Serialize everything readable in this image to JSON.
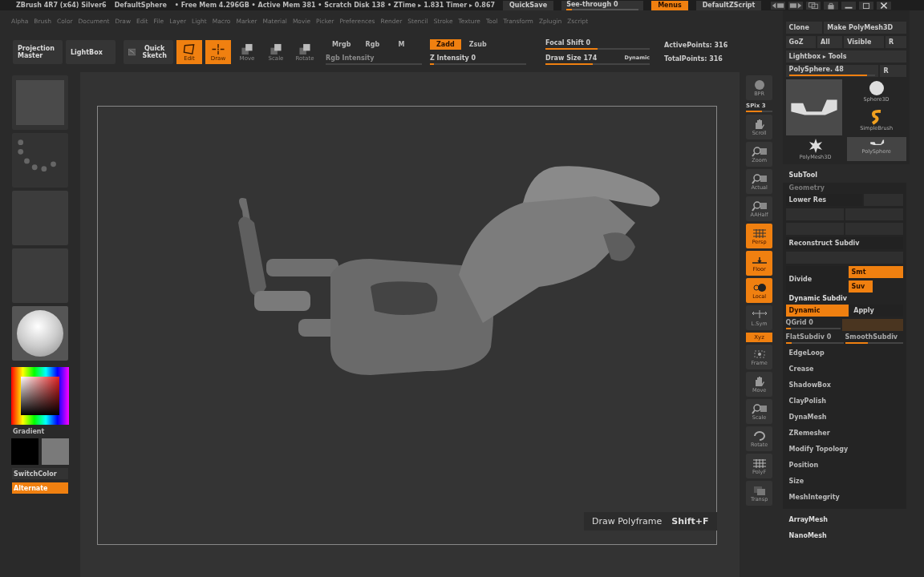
{
  "title_bar": {
    "app": "ZBrush 4R7 (x64) Silver6",
    "document": "DefaultSphere",
    "stats": "• Free Mem 4.296GB • Active Mem 381 • Scratch Disk 138 • ZTime ▸ 1.831 Timer ▸ 0.867",
    "quicksave": "QuickSave",
    "see_through": {
      "label": "See-through  0",
      "level": 0.08
    },
    "menus": {
      "label": "Menus",
      "on": true
    },
    "script": "DefaultZScript"
  },
  "menu_bar": [
    "Alpha",
    "Brush",
    "Color",
    "Document",
    "Draw",
    "Edit",
    "File",
    "Layer",
    "Light",
    "Macro",
    "Marker",
    "Material",
    "Movie",
    "Picker",
    "Preferences",
    "Render",
    "Stencil",
    "Stroke",
    "Texture",
    "Tool",
    "Transform",
    "Zplugin",
    "Zscript"
  ],
  "toolbar": {
    "buttons": [
      {
        "label": "Projection Master",
        "kind": "plain",
        "on": false
      },
      {
        "label": "LightBox",
        "kind": "plain",
        "on": false
      },
      {
        "label": "Quick Sketch",
        "kind": "sketch",
        "on": false
      },
      {
        "label": "Edit",
        "kind": "edit",
        "on": true
      },
      {
        "label": "Draw",
        "kind": "draw",
        "on": true
      },
      {
        "label": "Move",
        "kind": "move",
        "on": false
      },
      {
        "label": "Scale",
        "kind": "scale",
        "on": false
      },
      {
        "label": "Rotate",
        "kind": "rotate",
        "on": false
      }
    ],
    "color_modes": [
      {
        "label": "Mrgb",
        "on": false
      },
      {
        "label": "Rgb",
        "on": false
      },
      {
        "label": "M",
        "on": false
      }
    ],
    "rgb_intensity": {
      "label": "Rgb Intensity"
    },
    "depth_modes": [
      {
        "label": "Zadd",
        "on": true
      },
      {
        "label": "Zsub",
        "on": false
      }
    ],
    "z_intensity": {
      "label": "Z Intensity 0",
      "level": 0.0
    },
    "focal_shift": {
      "label": "Focal Shift 0",
      "level": 0.5
    },
    "draw_size": {
      "label": "Draw Size 174",
      "level": 0.45
    },
    "dynamic": "Dynamic",
    "active_points": "ActivePoints: 316",
    "total_points": "TotalPoints: 316"
  },
  "left_panel": {
    "thumbnails": [
      {
        "kind": "brush"
      },
      {
        "kind": "stroke"
      },
      {
        "kind": "alpha"
      },
      {
        "kind": "texture"
      },
      {
        "kind": "material"
      }
    ],
    "gradient": "Gradient",
    "switch_color": "SwitchColor",
    "alternate": {
      "label": "Alternate",
      "on": true
    }
  },
  "tooltip": {
    "label": "Draw Polyframe",
    "shortcut": "Shift+F"
  },
  "right_toolbar": [
    {
      "label": "BPR",
      "kind": "sphere",
      "on": false
    },
    {
      "label": "SPix 3",
      "kind": "slider",
      "level": 0.6
    },
    {
      "label": "Scroll",
      "kind": "hand",
      "on": false
    },
    {
      "label": "Zoom",
      "kind": "magnifier",
      "on": false
    },
    {
      "label": "Actual",
      "kind": "magnifier",
      "on": false
    },
    {
      "label": "AAHalf",
      "kind": "magnifier",
      "on": false
    },
    {
      "label": "Persp",
      "kind": "grid",
      "on": true
    },
    {
      "label": "Floor",
      "kind": "floor",
      "on": true
    },
    {
      "label": "Local",
      "kind": "local",
      "on": true
    },
    {
      "label": "L.Sym",
      "kind": "sym",
      "on": false
    },
    {
      "label": "Xyz",
      "kind": "small",
      "on": true
    },
    {
      "label": "Frame",
      "kind": "frame",
      "on": false
    },
    {
      "label": "Move",
      "kind": "hand",
      "on": false
    },
    {
      "label": "Scale",
      "kind": "magnifier",
      "on": false
    },
    {
      "label": "Rotate",
      "kind": "rotate",
      "on": false
    },
    {
      "label": "PolyF",
      "kind": "grid",
      "on": false
    },
    {
      "label": "Transp",
      "kind": "layers",
      "on": false
    }
  ],
  "tool_panel": {
    "rows": [
      [
        {
          "label": "Clone"
        },
        {
          "label": "Make PolyMesh3D"
        }
      ],
      [
        {
          "label": "GoZ"
        },
        {
          "label": "All"
        },
        {
          "label": "Visible"
        },
        {
          "label": "R"
        }
      ],
      [
        {
          "label": "Lightbox ▸ Tools"
        }
      ]
    ],
    "current_tool": {
      "label": "PolySphere. 48",
      "level": 0.9,
      "reset": "R"
    },
    "tools": [
      {
        "label": "Sphere3D",
        "kind": "sphere",
        "selected": false
      },
      {
        "label": "SimpleBrush",
        "kind": "brush",
        "selected": false
      },
      {
        "label": "PolyMesh3D",
        "kind": "star",
        "selected": false
      },
      {
        "label": "PolySphere",
        "kind": "model",
        "selected": true
      }
    ]
  },
  "subtool": "SubTool",
  "geometry": {
    "title": "Geometry",
    "lower_res": "Lower Res",
    "reconstruct": "Reconstruct Subdiv",
    "divide": "Divide",
    "smt": {
      "label": "Smt",
      "on": true
    },
    "suv": {
      "label": "Suv",
      "on": true
    },
    "dynamic_subdiv": "Dynamic Subdiv",
    "dynamic": {
      "label": "Dynamic",
      "on": true
    },
    "apply": "Apply",
    "qgrid": {
      "label": "QGrid 0",
      "level": 0.1
    },
    "flat_subdiv": {
      "label": "FlatSubdiv 0",
      "level": 0.1
    },
    "smooth_subdiv": {
      "label": "SmoothSubdiv",
      "level": 0.4
    },
    "sections": [
      "EdgeLoop",
      "Crease",
      "ShadowBox",
      "ClayPolish",
      "DynaMesh",
      "ZRemesher",
      "Modify Topology",
      "Position",
      "Size",
      "MeshIntegrity"
    ]
  },
  "more_sections": [
    "ArrayMesh",
    "NanoMesh"
  ]
}
